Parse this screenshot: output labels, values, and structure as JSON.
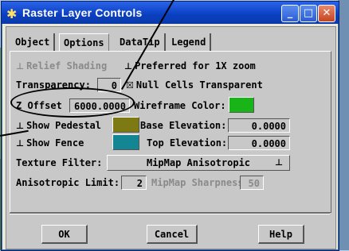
{
  "window": {
    "title": "Raster Layer Controls",
    "minimize": "_",
    "maximize": "□",
    "close": "✕"
  },
  "tabs": [
    {
      "label": "Object"
    },
    {
      "label": "Options"
    },
    {
      "label": "DataTip"
    },
    {
      "label": "Legend"
    }
  ],
  "options": {
    "relief_shading": "Relief Shading",
    "preferred_1x": "Preferred for 1X zoom",
    "transparency_label": "Transparency:",
    "transparency_value": "0",
    "null_cells": "Null Cells Transparent",
    "z_offset_label": "Z Offset",
    "z_offset_value": "6000.0000",
    "wireframe_label": "Wireframe Color:",
    "show_pedestal": "Show Pedestal",
    "base_elev_label": "Base Elevation:",
    "base_elev_value": "0.0000",
    "show_fence": "Show Fence",
    "top_elev_label": "Top Elevation:",
    "top_elev_value": "0.0000",
    "texture_filter_label": "Texture Filter:",
    "texture_filter_value": "MipMap Anisotropic",
    "aniso_label": "Anisotropic Limit:",
    "aniso_value": "2",
    "mipmap_label": "MipMap Sharpness:",
    "mipmap_value": "50"
  },
  "buttons": {
    "ok": "OK",
    "cancel": "Cancel",
    "help": "Help"
  },
  "colors": {
    "wireframe": "#18b418",
    "pedestal": "#7d7a14",
    "fence": "#138593"
  },
  "icons": {
    "checkbox_off": "⊥",
    "checkbox_on": "☒",
    "dropdown": "⊥"
  }
}
